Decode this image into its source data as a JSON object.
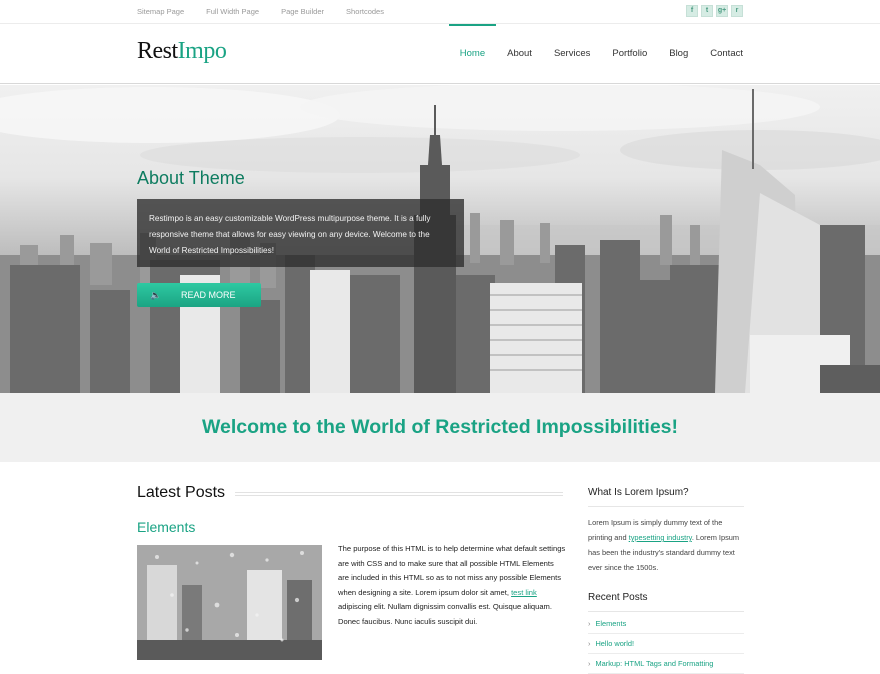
{
  "topbar": {
    "links": [
      "Sitemap Page",
      "Full Width Page",
      "Page Builder",
      "Shortcodes"
    ],
    "social_icons": [
      "facebook-icon",
      "twitter-icon",
      "google-plus-icon",
      "rss-icon"
    ],
    "social_glyphs": [
      "f",
      "t",
      "g+",
      "r"
    ]
  },
  "header": {
    "logo_part1": "Rest",
    "logo_part2": "Impo",
    "nav": [
      {
        "label": "Home",
        "active": true
      },
      {
        "label": "About"
      },
      {
        "label": "Services"
      },
      {
        "label": "Portfolio"
      },
      {
        "label": "Blog"
      },
      {
        "label": "Contact"
      }
    ]
  },
  "hero": {
    "title": "About Theme",
    "text": "Restimpo is an easy customizable WordPress multipurpose theme. It is a fully responsive theme that allows for easy viewing on any device. Welcome to the World of Restricted Impossibilities!",
    "button": "READ MORE"
  },
  "welcome": {
    "heading": "Welcome to the World of Restricted Impossibilities!"
  },
  "latest": {
    "heading": "Latest Posts",
    "post_title": "Elements",
    "post_text_1": "The purpose of this HTML is to help determine what default settings are with CSS and to make sure that all possible HTML Elements are included in this HTML so as to not miss any possible Elements when designing a site. Lorem ipsum dolor sit amet, ",
    "post_link": "test link",
    "post_text_2": " adipiscing elit. Nullam dignissim convallis est. Quisque aliquam. Donec faucibus. Nunc iaculis suscipit dui."
  },
  "sidebar": {
    "widget1_title": "What Is Lorem Ipsum?",
    "widget1_text_1": "Lorem Ipsum is simply dummy text of the printing and ",
    "widget1_link": "typesetting industry",
    "widget1_text_2": ". Lorem Ipsum has been the industry's standard dummy text ever since the 1500s.",
    "widget2_title": "Recent Posts",
    "recent": [
      "Elements",
      "Hello world!",
      "Markup: HTML Tags and Formatting"
    ]
  },
  "colors": {
    "accent": "#1aa384",
    "accent_dark": "#0e7c60",
    "welcome_bg": "#f0f0f0"
  }
}
